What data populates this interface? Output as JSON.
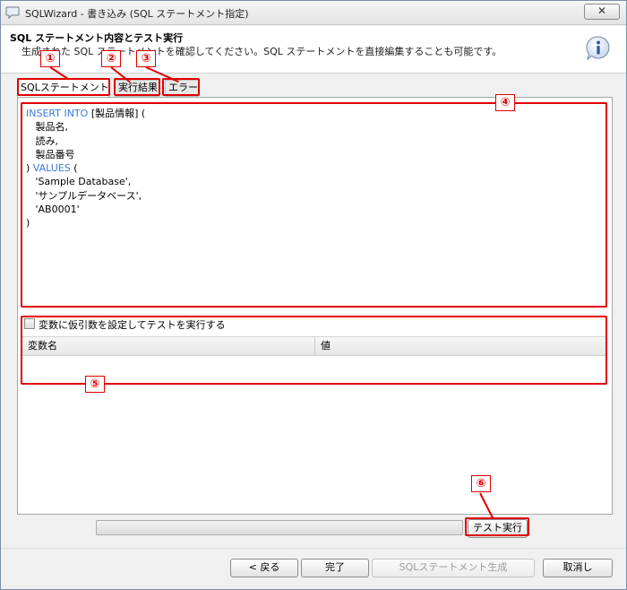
{
  "window": {
    "title": "SQLWizard - 書き込み (SQL ステートメント指定)",
    "close_label": "✕"
  },
  "header": {
    "title": "SQL ステートメント内容とテスト実行",
    "description": "生成された SQL ステートメントを確認してください。SQL ステートメントを直接編集することも可能です。",
    "icon": "info-icon"
  },
  "tabs": [
    {
      "label": "SQLステートメント",
      "active": true
    },
    {
      "label": "実行結果",
      "active": false
    },
    {
      "label": "エラー",
      "active": false
    }
  ],
  "sql": {
    "lines": [
      [
        {
          "t": "INSERT INTO",
          "kw": true
        },
        {
          "t": " [製品情報] (",
          "kw": false
        }
      ],
      [
        {
          "t": "   製品名,",
          "kw": false
        }
      ],
      [
        {
          "t": "   読み,",
          "kw": false
        }
      ],
      [
        {
          "t": "   製品番号",
          "kw": false
        }
      ],
      [
        {
          "t": ") ",
          "kw": false
        },
        {
          "t": "VALUES",
          "kw": true
        },
        {
          "t": " (",
          "kw": false
        }
      ],
      [
        {
          "t": "   'Sample Database',",
          "kw": false
        }
      ],
      [
        {
          "t": "   'サンプルデータベース',",
          "kw": false
        }
      ],
      [
        {
          "t": "   'AB0001'",
          "kw": false
        }
      ],
      [
        {
          "t": ")",
          "kw": false
        }
      ]
    ]
  },
  "variables": {
    "checkbox_label": "変数に仮引数を設定してテストを実行する",
    "checked": false,
    "columns": [
      "変数名",
      "値"
    ]
  },
  "buttons": {
    "test_run": "テスト実行",
    "back": "< 戻る",
    "finish": "完了",
    "generate_sql": "SQLステートメント生成",
    "cancel": "取消し"
  },
  "annotations": [
    "①",
    "②",
    "③",
    "④",
    "⑤",
    "⑥"
  ],
  "colors": {
    "annotation_red": "#e00000",
    "keyword_blue": "#3a7bd5"
  }
}
